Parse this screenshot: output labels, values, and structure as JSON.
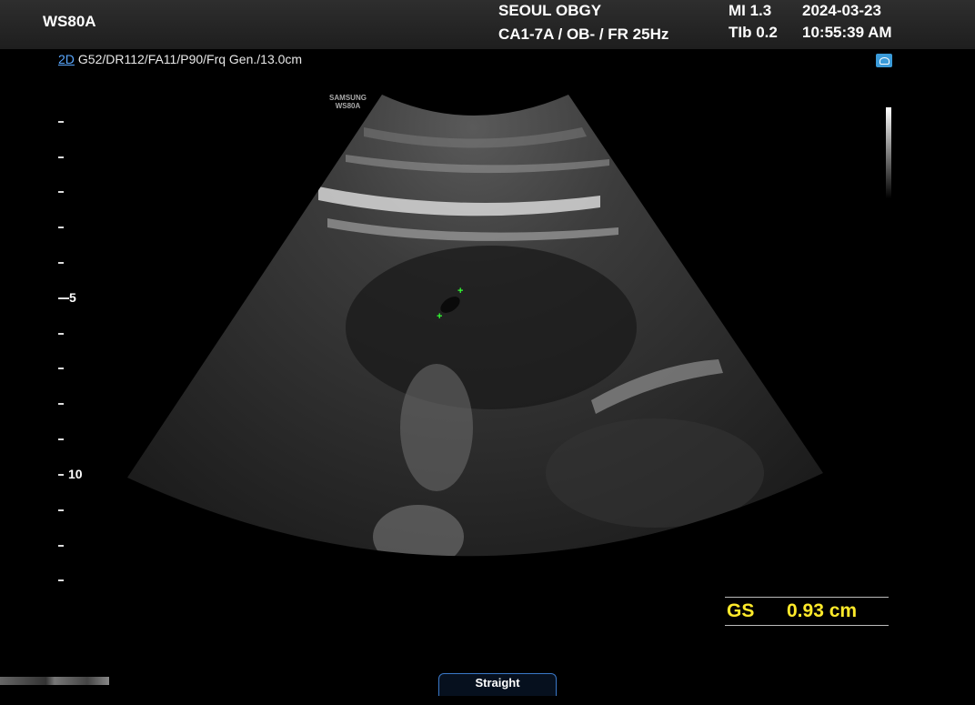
{
  "header": {
    "model": "WS80A",
    "hospital": "SEOUL OBGY",
    "probe_info": "CA1-7A / OB- / FR 25Hz",
    "mi": "MI  1.3",
    "tib": "TIb 0.2",
    "date": "2024-03-23",
    "time": "10:55:39 AM"
  },
  "imaging": {
    "mode": "2D",
    "parameters": "G52/DR112/FA11/P90/Frq Gen./13.0cm",
    "brand_line1": "SAMSUNG",
    "brand_line2": "WS80A"
  },
  "depth_scale": {
    "label_5": "5",
    "label_10": "10"
  },
  "measurement": {
    "label": "GS",
    "value": "0.93 cm"
  },
  "footer": {
    "straight_button": "Straight"
  },
  "colors": {
    "measurement_text": "#ffea2a",
    "mode_text": "#5aa8ff",
    "caliper": "#33ff33"
  }
}
